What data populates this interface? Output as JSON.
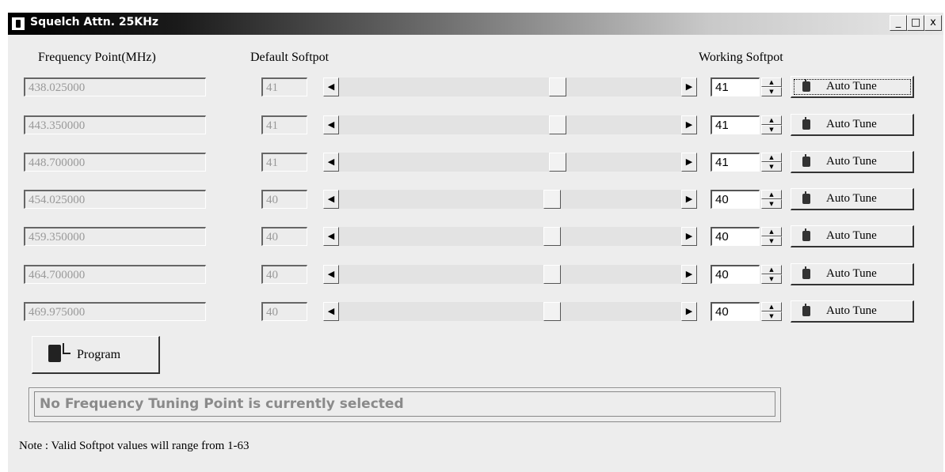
{
  "window": {
    "title": "Squelch Attn. 25KHz",
    "controls": {
      "minimize": "_",
      "maximize": "□",
      "close": "x"
    }
  },
  "headers": {
    "frequency": "Frequency Point(MHz)",
    "default": "Default Softpot",
    "working": "Working Softpot"
  },
  "rows": [
    {
      "frequency": "438.025000",
      "default": "41",
      "working": "41",
      "slider_value": 41,
      "button": "Auto Tune"
    },
    {
      "frequency": "443.350000",
      "default": "41",
      "working": "41",
      "slider_value": 41,
      "button": "Auto Tune"
    },
    {
      "frequency": "448.700000",
      "default": "41",
      "working": "41",
      "slider_value": 41,
      "button": "Auto Tune"
    },
    {
      "frequency": "454.025000",
      "default": "40",
      "working": "40",
      "slider_value": 40,
      "button": "Auto Tune"
    },
    {
      "frequency": "459.350000",
      "default": "40",
      "working": "40",
      "slider_value": 40,
      "button": "Auto Tune"
    },
    {
      "frequency": "464.700000",
      "default": "40",
      "working": "40",
      "slider_value": 40,
      "button": "Auto Tune"
    },
    {
      "frequency": "469.975000",
      "default": "40",
      "working": "40",
      "slider_value": 40,
      "button": "Auto Tune"
    }
  ],
  "slider_range": [
    1,
    63
  ],
  "program_button": "Program",
  "status": "No Frequency Tuning Point is currently selected",
  "note": "Note : Valid Softpot values will range from 1-63"
}
